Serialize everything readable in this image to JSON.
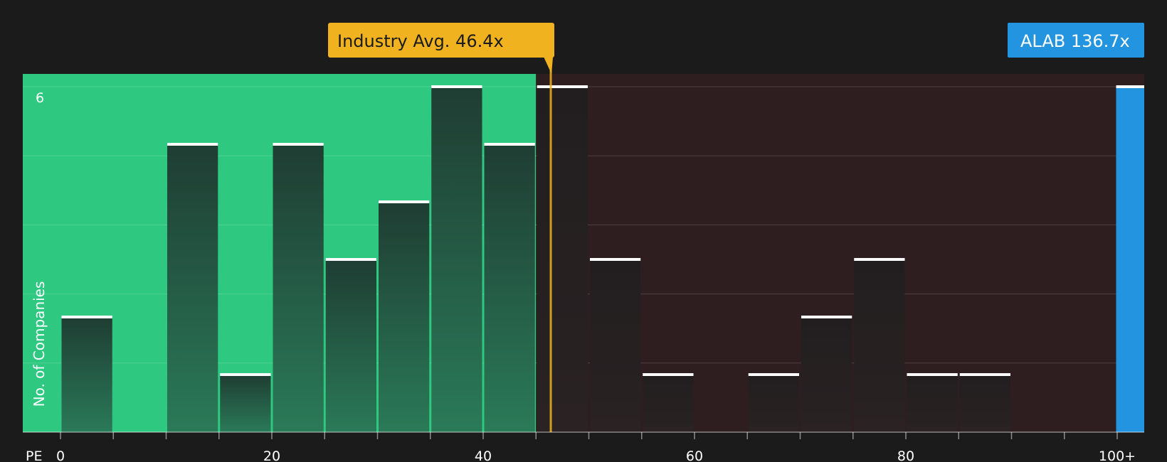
{
  "colors": {
    "background": "#1b1b1b",
    "below_avg_region": "#2ec880",
    "above_avg_region": "#2e1e1f",
    "bar_in_green": "#22473a",
    "bar_in_dark": "#221d1e",
    "bar_cap": "#ffffff",
    "industry_avg": "#f0b21e",
    "company": "#2394e0",
    "text": "#ffffff"
  },
  "chart_data": {
    "type": "bar",
    "x_axis_label": "PE",
    "ylabel": "No. of Companies",
    "ylim": [
      0,
      6
    ],
    "y_tick_labels": [
      {
        "value": 6,
        "label": "6"
      }
    ],
    "grid": true,
    "x_range": [
      -5,
      102.5
    ],
    "x_ticks": [
      {
        "value": 0,
        "label": "0"
      },
      {
        "value": 20,
        "label": "20"
      },
      {
        "value": 40,
        "label": "40"
      },
      {
        "value": 60,
        "label": "60"
      },
      {
        "value": 80,
        "label": "80"
      },
      {
        "value": 100,
        "label": "100+"
      }
    ],
    "bin_width": 5,
    "bins": [
      {
        "start": 0,
        "count": 2
      },
      {
        "start": 5,
        "count": 0
      },
      {
        "start": 10,
        "count": 5
      },
      {
        "start": 15,
        "count": 1
      },
      {
        "start": 20,
        "count": 5
      },
      {
        "start": 25,
        "count": 3
      },
      {
        "start": 30,
        "count": 4
      },
      {
        "start": 35,
        "count": 6
      },
      {
        "start": 40,
        "count": 5
      },
      {
        "start": 45,
        "count": 6
      },
      {
        "start": 50,
        "count": 3
      },
      {
        "start": 55,
        "count": 1
      },
      {
        "start": 60,
        "count": 0
      },
      {
        "start": 65,
        "count": 1
      },
      {
        "start": 70,
        "count": 2
      },
      {
        "start": 75,
        "count": 3
      },
      {
        "start": 80,
        "count": 1
      },
      {
        "start": 85,
        "count": 1
      },
      {
        "start": 90,
        "count": 0
      },
      {
        "start": 95,
        "count": 0
      },
      {
        "start": 100,
        "count": 6,
        "highlight": true
      }
    ],
    "industry_average": {
      "value": 46.4,
      "label": "Industry Avg. 46.4x"
    },
    "company": {
      "ticker": "ALAB",
      "value": 136.7,
      "label": "ALAB 136.7x"
    }
  }
}
